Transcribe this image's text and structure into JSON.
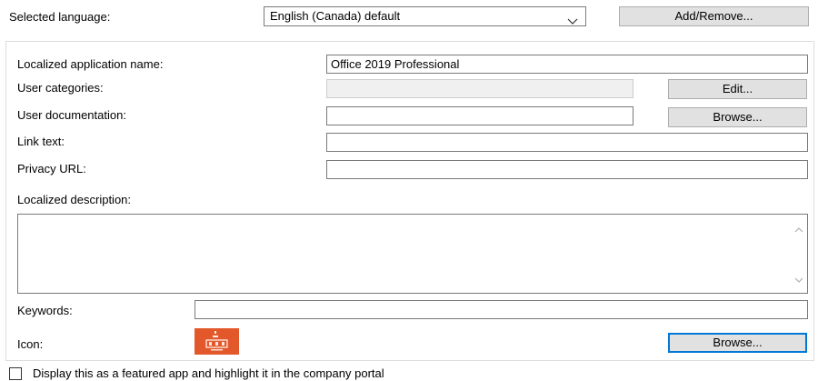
{
  "language": {
    "label": "Selected language:",
    "selected": "English (Canada) default",
    "add_remove_label": "Add/Remove..."
  },
  "form": {
    "app_name": {
      "label": "Localized application name:",
      "value": "Office 2019 Professional"
    },
    "user_categories": {
      "label": "User categories:",
      "value": "",
      "edit_label": "Edit..."
    },
    "user_documentation": {
      "label": "User documentation:",
      "value": "",
      "browse_label": "Browse..."
    },
    "link_text": {
      "label": "Link text:",
      "value": ""
    },
    "privacy_url": {
      "label": "Privacy URL:",
      "value": ""
    },
    "description": {
      "label": "Localized description:",
      "value": ""
    },
    "keywords": {
      "label": "Keywords:",
      "value": ""
    },
    "icon": {
      "label": "Icon:",
      "icon_name": "office-app-icon",
      "icon_color": "#e3582a",
      "browse_label": "Browse..."
    }
  },
  "featured": {
    "label": "Display this as a featured app and highlight it in the company portal",
    "checked": false
  },
  "colors": {
    "accent": "#0078d7",
    "button_face": "#e1e1e1",
    "input_border": "#7a7a7a",
    "disabled_field": "#f0f0f0"
  }
}
